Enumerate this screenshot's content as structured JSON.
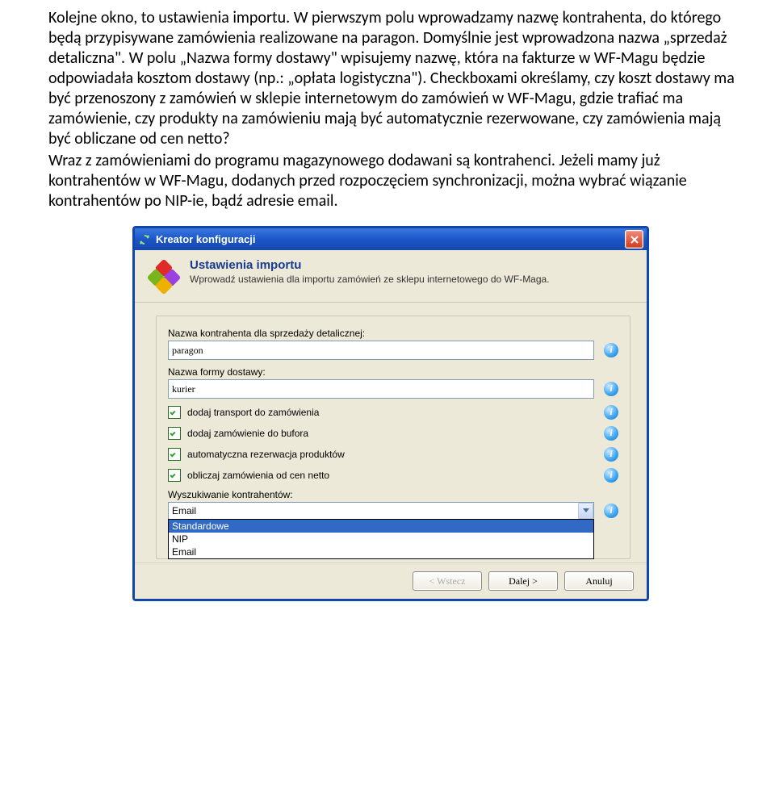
{
  "paragraphs": {
    "p1": "Kolejne okno, to ustawienia importu. W pierwszym polu wprowadzamy nazwę kontrahenta, do którego będą przypisywane zamówienia realizowane na paragon. Domyślnie jest wprowadzona nazwa „sprzedaż detaliczna\". W polu „Nazwa formy dostawy\" wpisujemy nazwę, która na fakturze w WF-Magu będzie odpowiadała kosztom dostawy (np.: „opłata logistyczna\"). Checkboxami określamy, czy koszt dostawy ma być przenoszony z zamówień w sklepie internetowym do zamówień w WF-Magu, gdzie trafiać ma zamówienie, czy produkty na zamówieniu mają być automatycznie rezerwowane, czy zamówienia mają być obliczane od cen netto?",
    "p2": "Wraz z zamówieniami do programu magazynowego dodawani są kontrahenci. Jeżeli mamy już kontrahentów w WF-Magu, dodanych przed rozpoczęciem synchronizacji, można wybrać wiązanie kontrahentów po NIP-ie, bądź adresie email."
  },
  "window": {
    "title": "Kreator konfiguracji",
    "header_title": "Ustawienia importu",
    "header_sub": "Wprowadź ustawienia dla importu zamówień ze sklepu internetowego do WF-Maga.",
    "field1_label": "Nazwa kontrahenta dla sprzedaży detalicznej:",
    "field1_value": "paragon",
    "field2_label": "Nazwa formy dostawy:",
    "field2_value": "kurier",
    "chk1": "dodaj transport do zamówienia",
    "chk2": "dodaj zamówienie do bufora",
    "chk3": "automatyczna rezerwacja produktów",
    "chk4": "obliczaj zamówienia od cen netto",
    "select_label": "Wyszukiwanie kontrahentów:",
    "select_value": "Email",
    "options": {
      "o1": "Standardowe",
      "o2": "NIP",
      "o3": "Email"
    },
    "btn_back": "< Wstecz",
    "btn_next": "Dalej >",
    "btn_cancel": "Anuluj"
  }
}
